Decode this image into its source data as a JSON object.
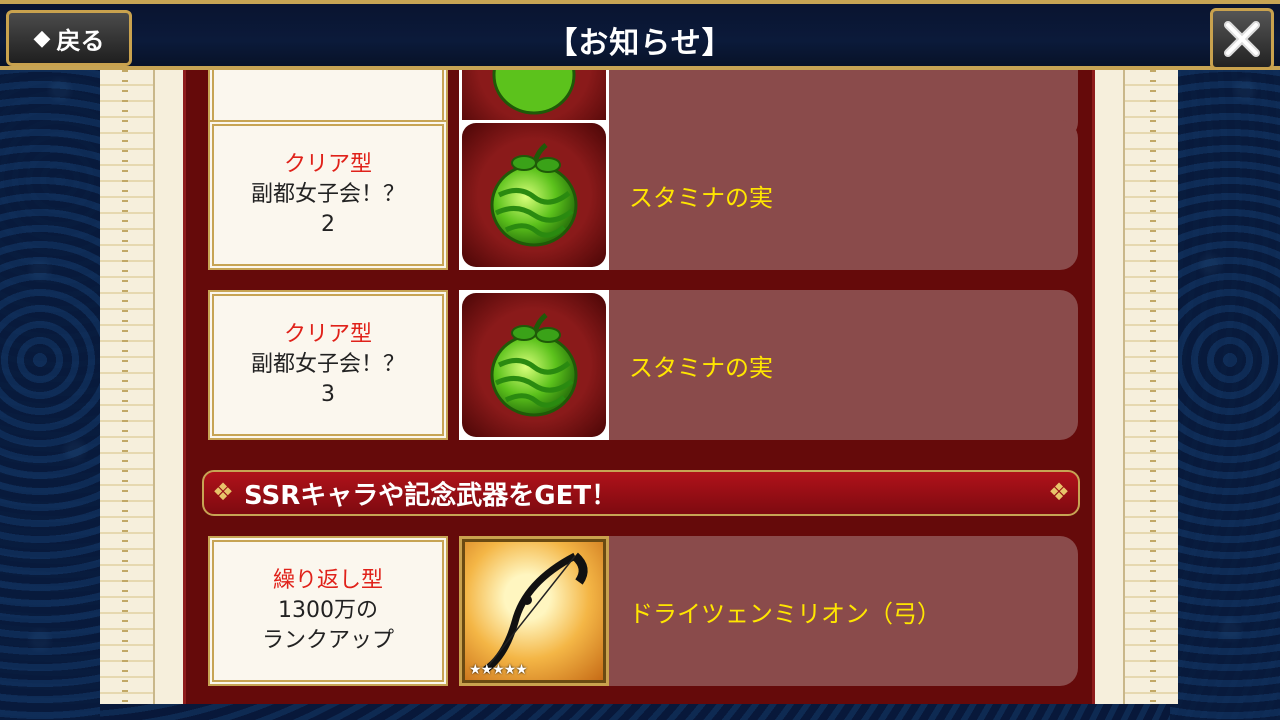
{
  "header": {
    "back_label": "戻る",
    "title": "【お知らせ】"
  },
  "rows": [
    {
      "type": "",
      "name_line1": "",
      "name_line2": "",
      "reward": "",
      "icon": "stamina-fruit-icon"
    },
    {
      "type": "クリア型",
      "name_line1": "副都女子会！？",
      "name_line2": "2",
      "reward": "スタミナの実",
      "icon": "stamina-fruit-icon"
    },
    {
      "type": "クリア型",
      "name_line1": "副都女子会！？",
      "name_line2": "3",
      "reward": "スタミナの実",
      "icon": "stamina-fruit-icon"
    }
  ],
  "section": {
    "title": "SSRキャラや記念武器をGET！"
  },
  "weapon_row": {
    "type": "繰り返し型",
    "name_line1": "1300万の",
    "name_line2": "ランクアップ",
    "reward": "ドライツェンミリオン（弓）",
    "stars": "★★★★★",
    "icon": "bow-weapon-icon"
  }
}
